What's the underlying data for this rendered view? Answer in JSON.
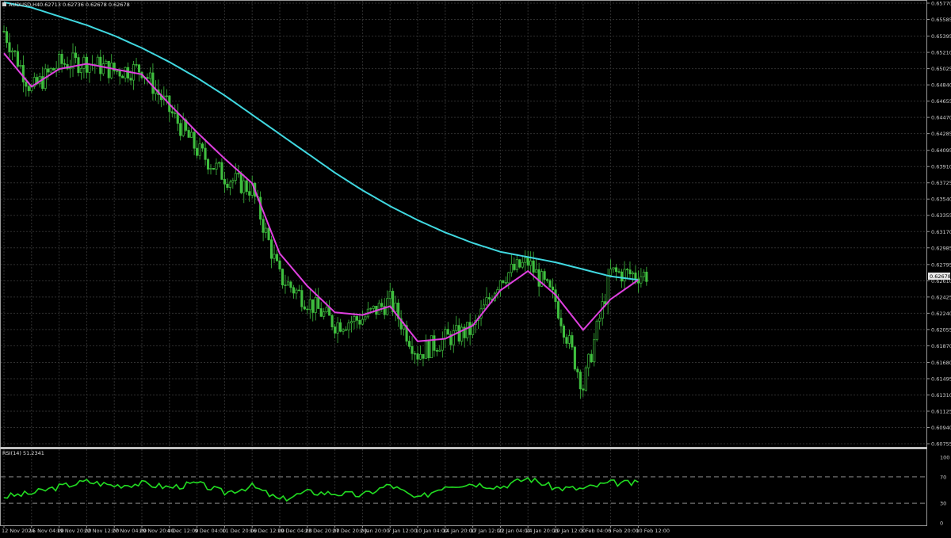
{
  "chart_header": {
    "symbol": "AUDUSD,H4",
    "quote": "0.62713 0.62736 0.62678 0.62678"
  },
  "rsi_header": "RSI(14) 51.2341",
  "last_price": "0.62678",
  "price_axis": [
    "0.65770",
    "0.65585",
    "0.65395",
    "0.65210",
    "0.65025",
    "0.64840",
    "0.64655",
    "0.64470",
    "0.64285",
    "0.64095",
    "0.63910",
    "0.63725",
    "0.63540",
    "0.63355",
    "0.63170",
    "0.62985",
    "0.62795",
    "0.62610",
    "0.62425",
    "0.62240",
    "0.62055",
    "0.61870",
    "0.61680",
    "0.61495",
    "0.61310",
    "0.61125",
    "0.60940",
    "0.60755"
  ],
  "rsi_axis": [
    "100",
    "70",
    "30",
    "0"
  ],
  "time_axis": [
    "12 Nov 2024",
    "15 Nov 04:00",
    "19 Nov 20:00",
    "22 Nov 12:00",
    "27 Nov 04:00",
    "29 Nov 20:00",
    "4 Dec 12:00",
    "9 Dec 04:00",
    "11 Dec 20:00",
    "16 Dec 12:00",
    "19 Dec 04:00",
    "23 Dec 20:00",
    "27 Dec 20:00",
    "2 Jan 20:00",
    "7 Jan 12:00",
    "10 Jan 04:00",
    "14 Jan 20:00",
    "17 Jan 12:00",
    "22 Jan 04:00",
    "24 Jan 20:00",
    "29 Jan 12:00",
    "3 Feb 04:00",
    "5 Feb 20:00",
    "10 Feb 12:00"
  ],
  "colors": {
    "background": "#000000",
    "grid": "#2f2f2f",
    "candle": "#3fbf3f",
    "ma_fast": "#e040e0",
    "ma_slow": "#40d8e0",
    "rsi_line": "#22dd22",
    "axis_text": "#cfcfcf"
  },
  "chart_data": {
    "type": "line",
    "title": "AUDUSD,H4",
    "x": [
      "12 Nov 2024",
      "15 Nov 04:00",
      "19 Nov 20:00",
      "22 Nov 12:00",
      "27 Nov 04:00",
      "29 Nov 20:00",
      "4 Dec 12:00",
      "9 Dec 04:00",
      "11 Dec 20:00",
      "16 Dec 12:00",
      "19 Dec 04:00",
      "23 Dec 20:00",
      "27 Dec 20:00",
      "2 Jan 20:00",
      "7 Jan 12:00",
      "10 Jan 04:00",
      "14 Jan 20:00",
      "17 Jan 12:00",
      "22 Jan 04:00",
      "24 Jan 20:00",
      "29 Jan 12:00",
      "3 Feb 04:00",
      "5 Feb 20:00",
      "10 Feb 12:00"
    ],
    "ylim": [
      0.60755,
      0.6577
    ],
    "grid": true,
    "series": [
      {
        "values": [
          0.6545,
          0.6478,
          0.6508,
          0.651,
          0.65,
          0.6502,
          0.6455,
          0.641,
          0.638,
          0.6365,
          0.6265,
          0.6238,
          0.6212,
          0.6218,
          0.6238,
          0.6178,
          0.6195,
          0.6205,
          0.6265,
          0.6282,
          0.6238,
          0.614,
          0.627,
          0.6268
        ]
      },
      {
        "values": [
          0.652,
          0.6482,
          0.6502,
          0.6508,
          0.6502,
          0.6496,
          0.6462,
          0.643,
          0.64,
          0.6372,
          0.6292,
          0.6255,
          0.6225,
          0.6222,
          0.6232,
          0.6192,
          0.6195,
          0.621,
          0.625,
          0.6272,
          0.6245,
          0.6205,
          0.624,
          0.6262
        ]
      },
      {
        "values": [
          0.6578,
          0.6572,
          0.6562,
          0.6552,
          0.654,
          0.6526,
          0.651,
          0.6492,
          0.6472,
          0.645,
          0.6428,
          0.6406,
          0.6384,
          0.6364,
          0.6346,
          0.633,
          0.6316,
          0.6304,
          0.6294,
          0.6288,
          0.6282,
          0.6274,
          0.6266,
          0.6262
        ]
      }
    ],
    "rsi": {
      "ylim": [
        0,
        100
      ],
      "levels": [
        70,
        30
      ],
      "values": [
        40,
        45,
        55,
        63,
        57,
        60,
        54,
        60,
        46,
        56,
        35,
        47,
        45,
        42,
        58,
        36,
        57,
        60,
        55,
        68,
        53,
        52,
        61,
        60
      ]
    }
  }
}
